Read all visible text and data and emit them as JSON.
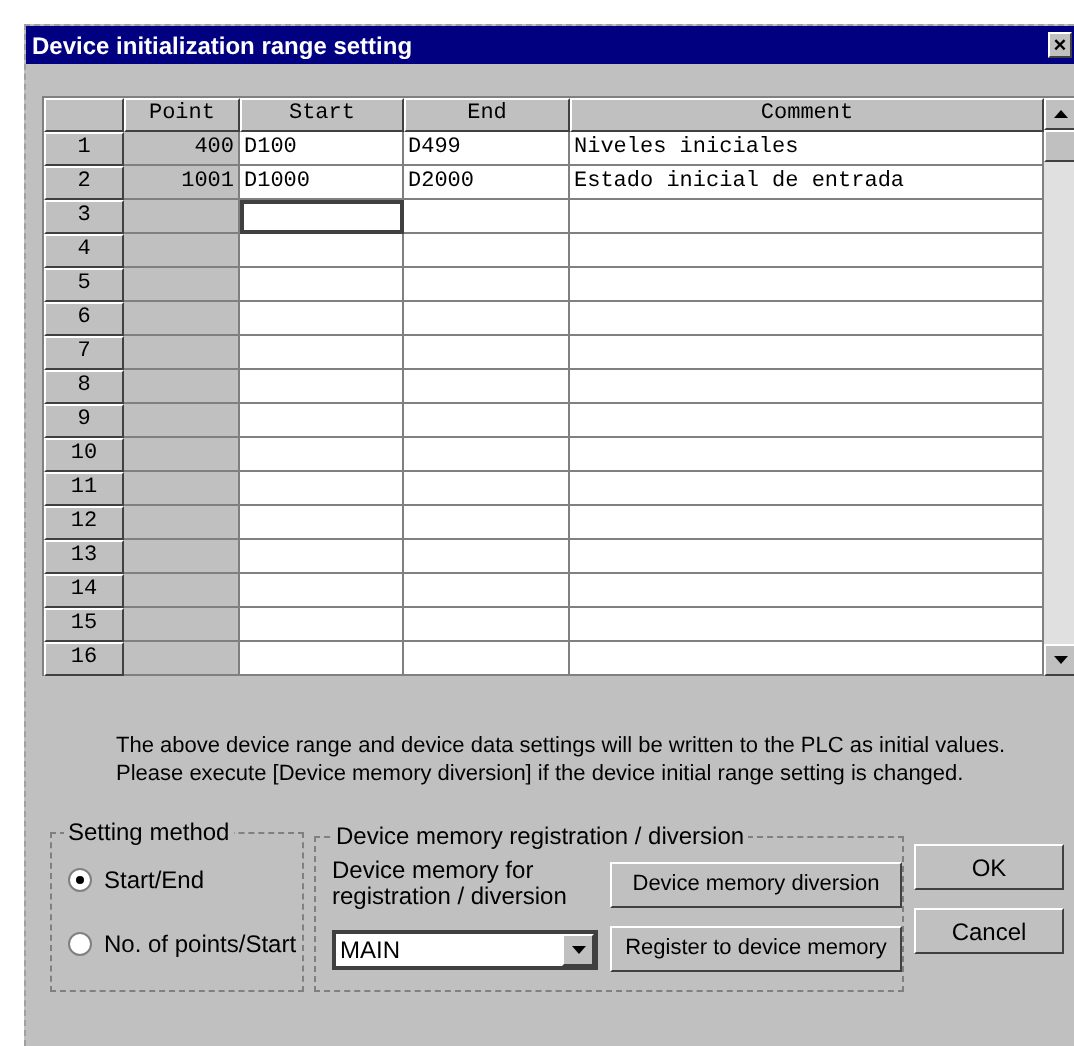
{
  "window": {
    "title": "Device initialization range setting",
    "close": "×"
  },
  "table": {
    "columns": [
      "Point",
      "Start",
      "End",
      "Comment"
    ],
    "rows": [
      {
        "number": "1",
        "point": "400",
        "start": "D100",
        "end": "D499",
        "comment": "Niveles iniciales",
        "focused": false
      },
      {
        "number": "2",
        "point": "1001",
        "start": "D1000",
        "end": "D2000",
        "comment": "Estado inicial de entrada",
        "focused": false
      },
      {
        "number": "3",
        "focused": true
      },
      {
        "number": "4",
        "focused": false
      },
      {
        "number": "5",
        "focused": false
      },
      {
        "number": "6",
        "focused": false
      },
      {
        "number": "7",
        "focused": false
      },
      {
        "number": "8",
        "focused": false
      },
      {
        "number": "9",
        "focused": false
      },
      {
        "number": "10",
        "focused": false
      },
      {
        "number": "11",
        "focused": false
      },
      {
        "number": "12",
        "focused": false
      },
      {
        "number": "13",
        "focused": false
      },
      {
        "number": "14",
        "focused": false
      },
      {
        "number": "15",
        "focused": false
      },
      {
        "number": "16",
        "focused": false
      }
    ]
  },
  "notice": [
    "The above device range and device data settings will be written to the PLC as initial values.",
    "Please execute [Device memory diversion] if the device initial range setting is changed."
  ],
  "setting_method": {
    "title": "Setting method",
    "options": [
      {
        "label": "Start/End",
        "selected": true
      },
      {
        "label": "No. of points/Start",
        "selected": false
      }
    ]
  },
  "memory_group": {
    "title": "Device memory registration / diversion",
    "field_label": "Device memory for registration / diversion",
    "dropdown": {
      "value": "MAIN"
    },
    "buttons": [
      "Device memory diversion",
      "Register to device memory"
    ]
  },
  "dialog_buttons": [
    "OK",
    "Cancel"
  ]
}
